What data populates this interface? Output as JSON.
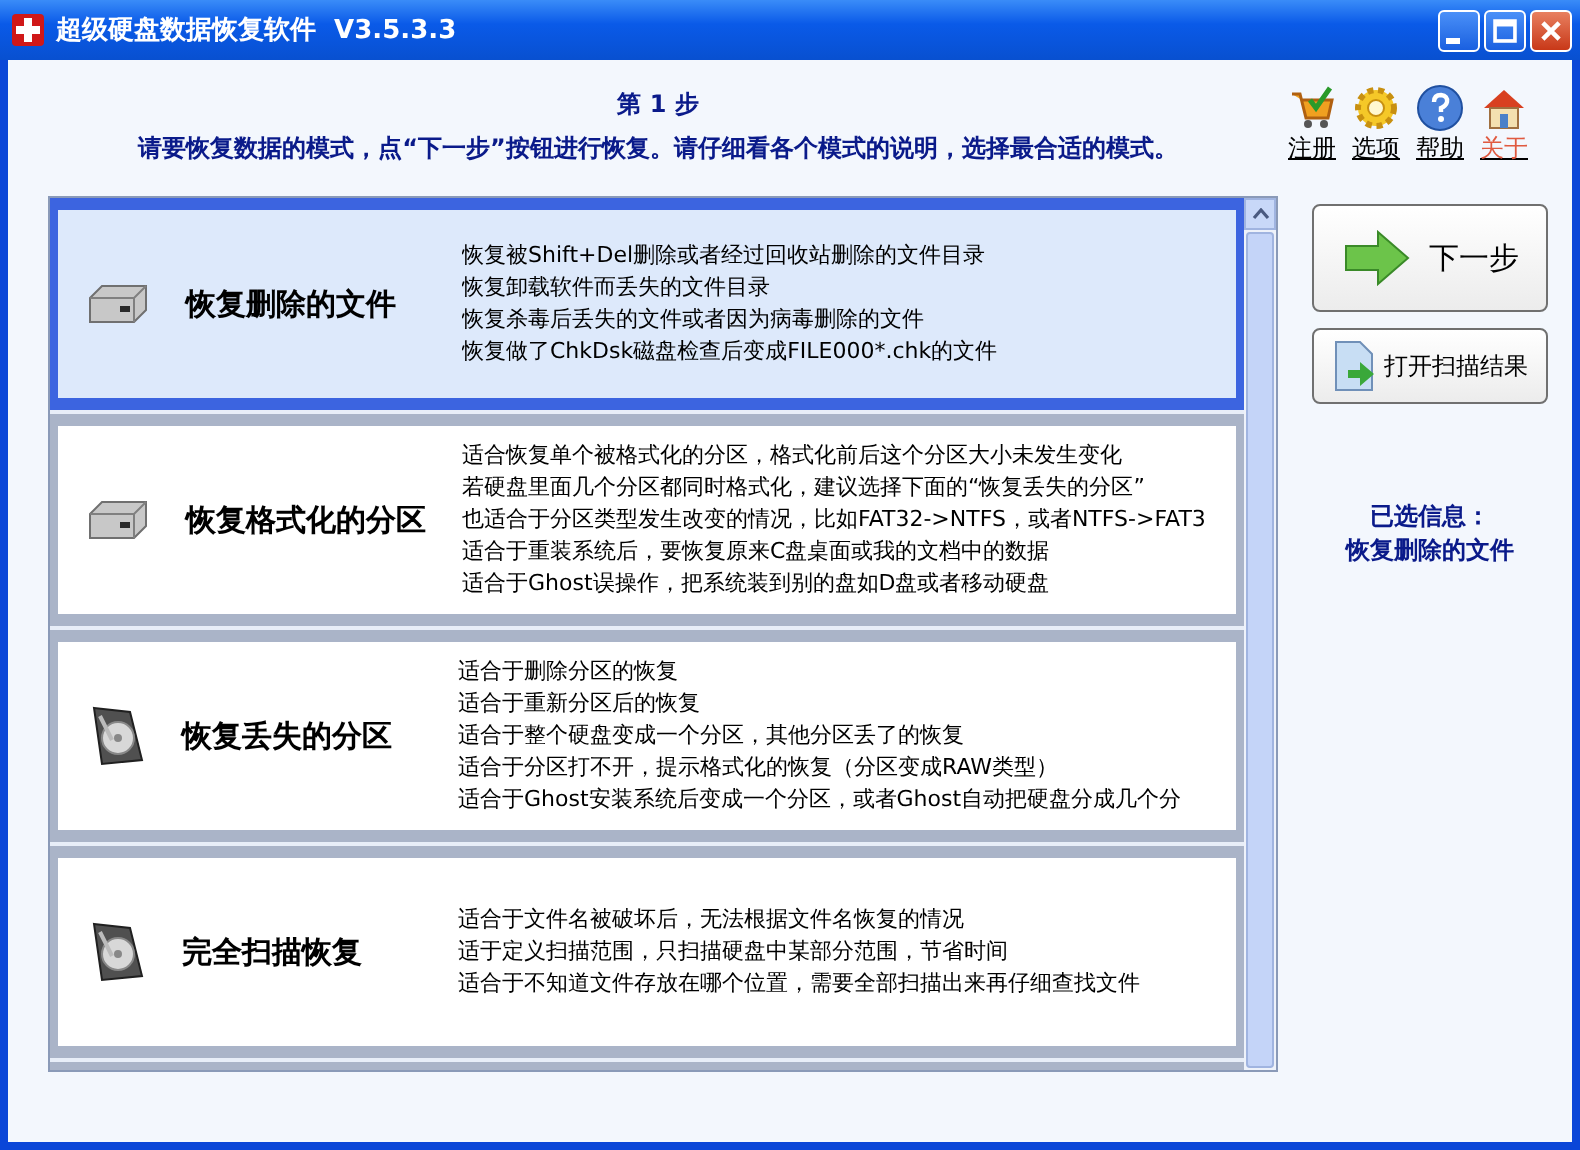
{
  "window": {
    "title": "超级硬盘数据恢复软件  V3.5.3.3"
  },
  "header": {
    "step": "第 1 步",
    "instruction": "请要恢复数据的模式，点“下一步”按钮进行恢复。请仔细看各个模式的说明，选择最合适的模式。"
  },
  "toolbar": [
    {
      "label": "注册",
      "kind": "cart"
    },
    {
      "label": "选项",
      "kind": "gear"
    },
    {
      "label": "帮助",
      "kind": "help"
    },
    {
      "label": "关于",
      "kind": "home"
    }
  ],
  "modes": [
    {
      "title": "恢复删除的文件",
      "selected": true,
      "kind": "flat",
      "lines": [
        "恢复被Shift+Del删除或者经过回收站删除的文件目录",
        "恢复卸载软件而丢失的文件目录",
        "恢复杀毒后丢失的文件或者因为病毒删除的文件",
        "恢复做了ChkDsk磁盘检查后变成FILE000*.chk的文件"
      ]
    },
    {
      "title": "恢复格式化的分区",
      "selected": false,
      "kind": "flat",
      "lines": [
        "适合恢复单个被格式化的分区，格式化前后这个分区大小未发生变化",
        "若硬盘里面几个分区都同时格式化，建议选择下面的“恢复丢失的分区”",
        "也适合于分区类型发生改变的情况，比如FAT32->NTFS，或者NTFS->FAT3",
        "适合于重装系统后，要恢复原来C盘桌面或我的文档中的数据",
        "适合于Ghost误操作，把系统装到别的盘如D盘或者移动硬盘"
      ]
    },
    {
      "title": "恢复丢失的分区",
      "selected": false,
      "kind": "open",
      "lines": [
        "适合于删除分区的恢复",
        "适合于重新分区后的恢复",
        "适合于整个硬盘变成一个分区，其他分区丢了的恢复",
        "适合于分区打不开，提示格式化的恢复（分区变成RAW类型）",
        "适合于Ghost安装系统后变成一个分区，或者Ghost自动把硬盘分成几个分"
      ]
    },
    {
      "title": "完全扫描恢复",
      "selected": false,
      "kind": "open",
      "lines": [
        "适合于文件名被破坏后，无法根据文件名恢复的情况",
        "适于定义扫描范围，只扫描硬盘中某部分范围，节省时间",
        "适合于不知道文件存放在哪个位置，需要全部扫描出来再仔细查找文件"
      ]
    }
  ],
  "actions": {
    "next": "下一步",
    "open_results": "打开扫描结果"
  },
  "selection_info": {
    "label": "已选信息：",
    "value": "恢复删除的文件"
  }
}
